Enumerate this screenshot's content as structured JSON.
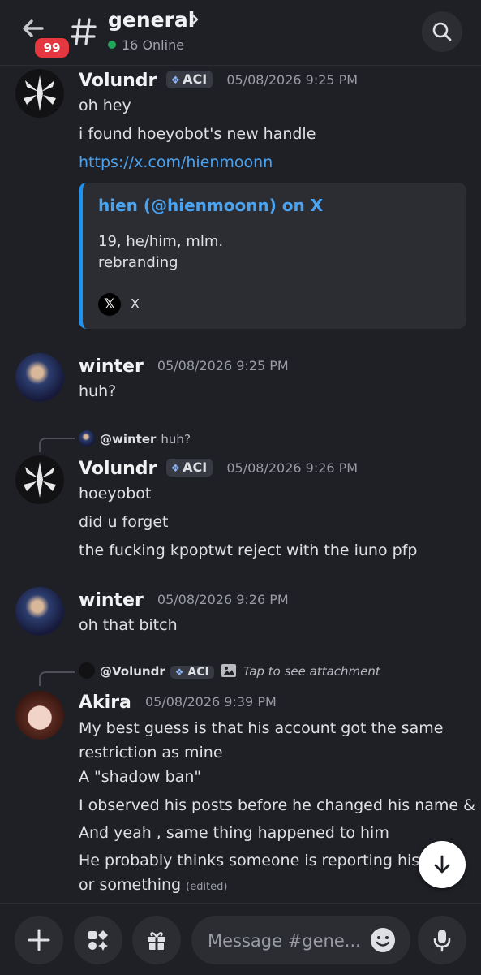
{
  "header": {
    "unread_badge": "99",
    "channel_name": "general",
    "online_text": "16 Online"
  },
  "messages": [
    {
      "author": "Volundr",
      "tag": "ACI",
      "timestamp": "05/08/2026 9:25 PM",
      "lines": [
        "oh hey",
        "i found hoeyobot's new handle",
        "https://x.com/hienmoonn"
      ],
      "embed": {
        "title": "hien (@hienmoonn) on X",
        "description": "19, he/him, mlm.\nrebranding",
        "footer": "X"
      }
    },
    {
      "author": "winter",
      "timestamp": "05/08/2026 9:25 PM",
      "lines": [
        "huh?"
      ]
    },
    {
      "reply_to": {
        "name": "@winter",
        "text": "huh?"
      },
      "author": "Volundr",
      "tag": "ACI",
      "timestamp": "05/08/2026 9:26 PM",
      "lines": [
        "hoeyobot",
        "did u forget",
        "the fucking kpoptwt reject with the iuno pfp"
      ]
    },
    {
      "author": "winter",
      "timestamp": "05/08/2026 9:26 PM",
      "lines": [
        "oh that bitch"
      ]
    },
    {
      "reply_to": {
        "name": "@Volundr",
        "tag": "ACI",
        "text": "Tap to see attachment"
      },
      "author": "Akira",
      "timestamp": "05/08/2026 9:39 PM",
      "lines": [
        "My best guess is that his account got the same",
        "restriction as mine",
        "A \"shadow ban\"",
        "I observed his posts before he changed his name & @",
        "And yeah , same thing happened to him",
        "He probably thinks someone is reporting his ac",
        "or something"
      ],
      "edited_label": "(edited)"
    }
  ],
  "composer": {
    "placeholder": "Message #gene..."
  },
  "colors": {
    "background": "#1f2026",
    "link": "#4aa3f0",
    "badge": "#e5373f",
    "online": "#23a55a",
    "embed_border": "#1e94f0"
  },
  "icons": [
    "back-arrow-icon",
    "hash-icon",
    "chevron-right-icon",
    "search-icon",
    "scroll-down-arrow-icon",
    "plus-icon",
    "apps-icon",
    "gift-icon",
    "emoji-icon",
    "microphone-icon",
    "image-icon",
    "x-logo-icon"
  ]
}
